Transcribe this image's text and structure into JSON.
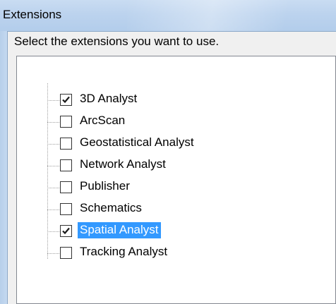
{
  "window": {
    "title": "Extensions"
  },
  "prompt": "Select the extensions you want to use.",
  "extensions": [
    {
      "label": "3D Analyst",
      "checked": true,
      "selected": false
    },
    {
      "label": "ArcScan",
      "checked": false,
      "selected": false
    },
    {
      "label": "Geostatistical Analyst",
      "checked": false,
      "selected": false
    },
    {
      "label": "Network Analyst",
      "checked": false,
      "selected": false
    },
    {
      "label": "Publisher",
      "checked": false,
      "selected": false
    },
    {
      "label": "Schematics",
      "checked": false,
      "selected": false
    },
    {
      "label": "Spatial Analyst",
      "checked": true,
      "selected": true
    },
    {
      "label": "Tracking Analyst",
      "checked": false,
      "selected": false
    }
  ],
  "colors": {
    "selection_background": "#3399ff",
    "selection_text": "#ffffff",
    "titlebar": "#bcd3ee",
    "dialog_background": "#f0f0f0"
  },
  "icons": {
    "check": "checkmark-icon"
  }
}
